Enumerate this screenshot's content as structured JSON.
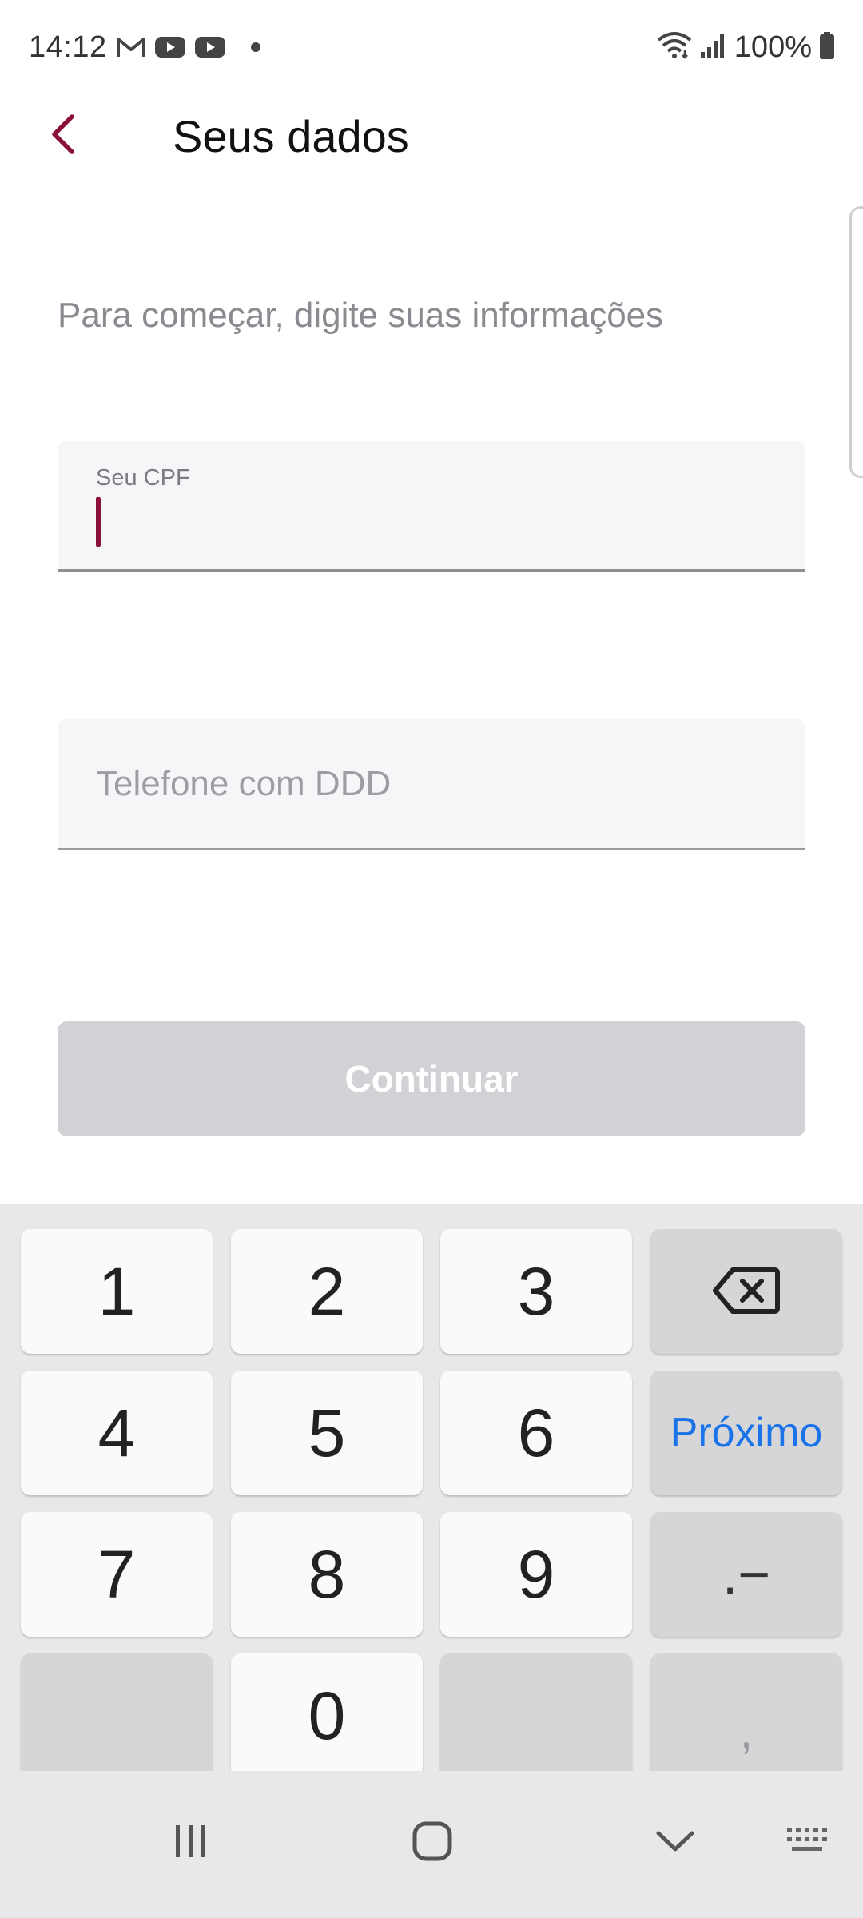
{
  "status_bar": {
    "time": "14:12",
    "battery": "100%",
    "left_icons": [
      "gmail-icon",
      "youtube-icon",
      "youtube-icon",
      "dot-icon"
    ],
    "right_icons": [
      "wifi-icon",
      "signal-icon",
      "battery-icon"
    ]
  },
  "header": {
    "title": "Seus dados",
    "back_icon": "chevron-left-icon"
  },
  "form": {
    "subtitle": "Para começar, digite suas informações",
    "cpf_label": "Seu CPF",
    "cpf_value": "",
    "phone_placeholder": "Telefone com DDD",
    "phone_value": "",
    "continue_label": "Continuar"
  },
  "keyboard": {
    "keys": {
      "k1": "1",
      "k2": "2",
      "k3": "3",
      "k4": "4",
      "k5": "5",
      "k6": "6",
      "k7": "7",
      "k8": "8",
      "k9": "9",
      "k0": "0",
      "next": "Próximo",
      "punct": ".−",
      "comma": ","
    },
    "backspace_icon": "backspace-icon"
  },
  "nav_bar": {
    "icons": [
      "recents-icon",
      "home-icon",
      "back-down-icon",
      "keyboard-switch-icon"
    ]
  },
  "colors": {
    "accent": "#8a0f3a",
    "button_disabled": "#d1d1d6",
    "next_key": "#1a73e8",
    "keyboard_bg": "#e8e8ea"
  }
}
